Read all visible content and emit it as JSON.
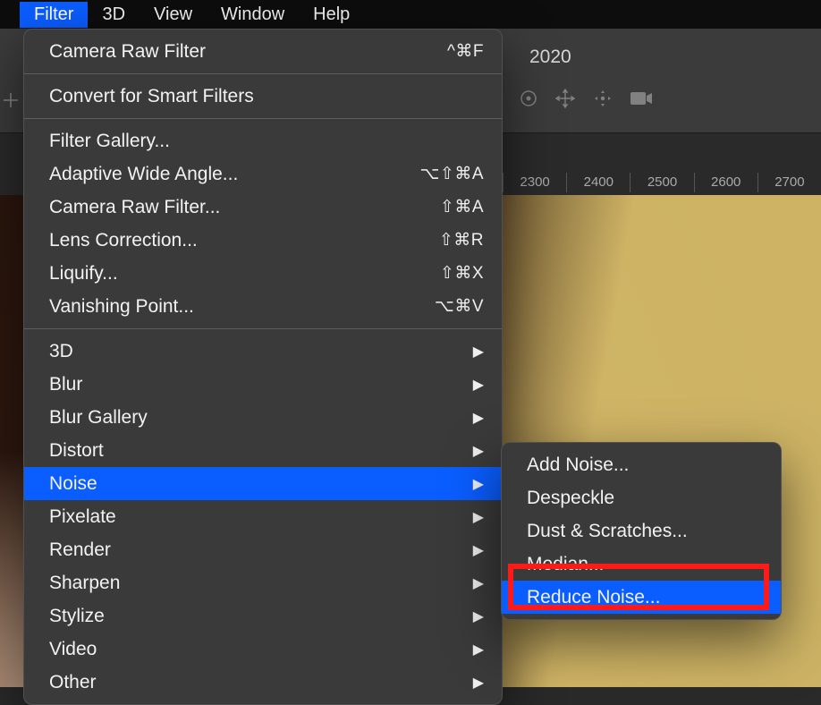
{
  "menubar": {
    "items": [
      {
        "label": "Filter",
        "active": true
      },
      {
        "label": "3D"
      },
      {
        "label": "View"
      },
      {
        "label": "Window"
      },
      {
        "label": "Help"
      }
    ]
  },
  "doc_info_fragment": "2020",
  "ruler_ticks": [
    "2300",
    "2400",
    "2500",
    "2600",
    "2700"
  ],
  "filter_menu": {
    "sections": [
      [
        {
          "label": "Camera Raw Filter",
          "accel": "^⌘F"
        }
      ],
      [
        {
          "label": "Convert for Smart Filters"
        }
      ],
      [
        {
          "label": "Filter Gallery..."
        },
        {
          "label": "Adaptive Wide Angle...",
          "accel": "⌥⇧⌘A"
        },
        {
          "label": "Camera Raw Filter...",
          "accel": "⇧⌘A"
        },
        {
          "label": "Lens Correction...",
          "accel": "⇧⌘R"
        },
        {
          "label": "Liquify...",
          "accel": "⇧⌘X"
        },
        {
          "label": "Vanishing Point...",
          "accel": "⌥⌘V"
        }
      ],
      [
        {
          "label": "3D",
          "submenu": true
        },
        {
          "label": "Blur",
          "submenu": true
        },
        {
          "label": "Blur Gallery",
          "submenu": true
        },
        {
          "label": "Distort",
          "submenu": true
        },
        {
          "label": "Noise",
          "submenu": true,
          "selected": true
        },
        {
          "label": "Pixelate",
          "submenu": true
        },
        {
          "label": "Render",
          "submenu": true
        },
        {
          "label": "Sharpen",
          "submenu": true
        },
        {
          "label": "Stylize",
          "submenu": true
        },
        {
          "label": "Video",
          "submenu": true
        },
        {
          "label": "Other",
          "submenu": true
        }
      ]
    ]
  },
  "noise_submenu": {
    "items": [
      {
        "label": "Add Noise..."
      },
      {
        "label": "Despeckle"
      },
      {
        "label": "Dust & Scratches..."
      },
      {
        "label": "Median..."
      },
      {
        "label": "Reduce Noise...",
        "highlighted": true,
        "red_callout": true
      }
    ]
  },
  "icons": {
    "target": "target-icon",
    "move_all": "move-all-icon",
    "move_free": "move-free-icon",
    "camera": "camera-icon"
  }
}
